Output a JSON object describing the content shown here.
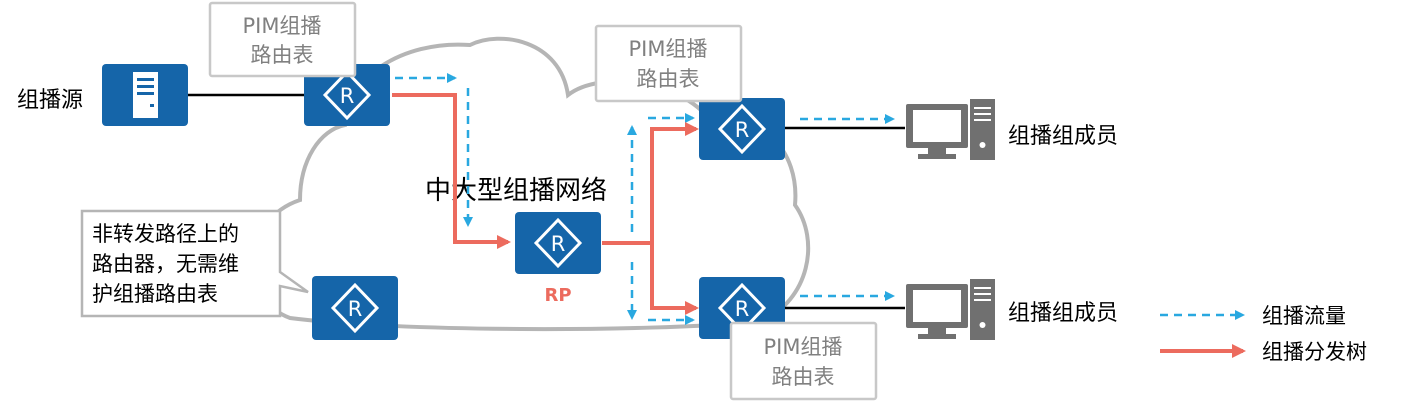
{
  "network_label": "中大型组播网络",
  "source_label": "组播源",
  "receiver_labels": [
    "组播组成员",
    "组播组成员"
  ],
  "rp_label": "RP",
  "router_glyph": "R",
  "routing_table_callouts": [
    [
      "PIM组播",
      "路由表"
    ],
    [
      "PIM组播",
      "路由表"
    ],
    [
      "PIM组播",
      "路由表"
    ]
  ],
  "non_forwarding_note": [
    "非转发路径上的",
    "路由器，无需维",
    "护组播路由表"
  ],
  "legend": {
    "multicast_traffic": "组播流量",
    "distribution_tree": "组播分发树"
  },
  "colors": {
    "router_fill": "#1565a9",
    "traffic_arrow": "#29a8e0",
    "tree_arrow": "#ec6b5e",
    "rp_text": "#ec6b5e",
    "cloud_stroke": "#b5b5b5",
    "pc_fill": "#707070",
    "callout_text": "#808080"
  },
  "icons": [
    "router-icon",
    "server-icon",
    "computer-icon"
  ]
}
